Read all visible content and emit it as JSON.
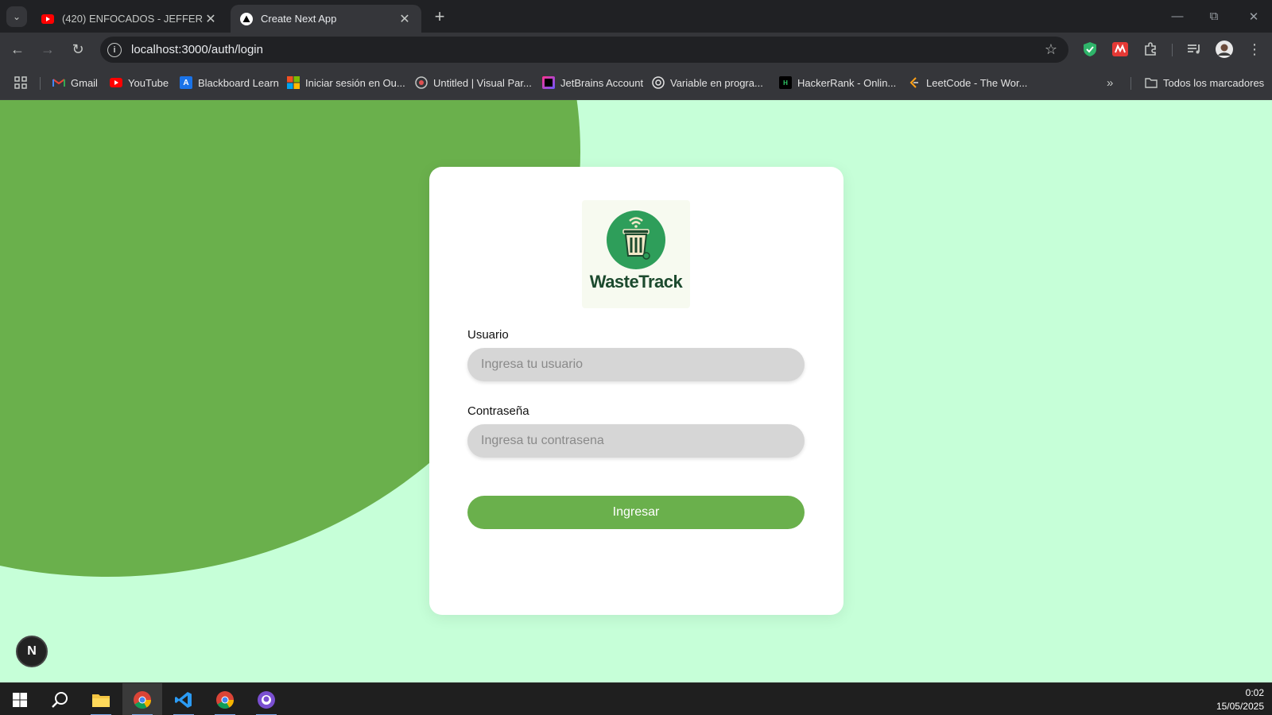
{
  "browser": {
    "tabs": [
      {
        "label": "(420) ENFOCADOS - JEFFERSON",
        "icon": "youtube-icon",
        "active": false
      },
      {
        "label": "Create Next App",
        "icon": "nextjs-icon",
        "active": true
      }
    ],
    "url": "localhost:3000/auth/login",
    "bookmarks": [
      {
        "label": "Gmail",
        "icon": "gmail-icon"
      },
      {
        "label": "YouTube",
        "icon": "youtube-icon"
      },
      {
        "label": "Blackboard Learn",
        "icon": "blackboard-icon"
      },
      {
        "label": "Iniciar sesión en Ou...",
        "icon": "microsoft-icon"
      },
      {
        "label": "Untitled | Visual Par...",
        "icon": "visual-paradigm-icon"
      },
      {
        "label": "JetBrains Account",
        "icon": "jetbrains-icon"
      },
      {
        "label": "Variable en progra...",
        "icon": "openai-icon"
      },
      {
        "label": "HackerRank - Onlin...",
        "icon": "hackerrank-icon"
      },
      {
        "label": "LeetCode - The Wor...",
        "icon": "leetcode-icon"
      }
    ],
    "all_bookmarks_label": "Todos los marcadores"
  },
  "login": {
    "logo_text": "WasteTrack",
    "username_label": "Usuario",
    "username_placeholder": "Ingresa tu usuario",
    "password_label": "Contraseña",
    "password_placeholder": "Ingresa tu contrasena",
    "submit_label": "Ingresar"
  },
  "next_badge": "N",
  "taskbar": {
    "time": "0:02",
    "date": "15/05/2025"
  },
  "colors": {
    "page_background": "#c6ffd8",
    "accent_green": "#6ab04c",
    "logo_dark_green": "#1c4a2e"
  }
}
